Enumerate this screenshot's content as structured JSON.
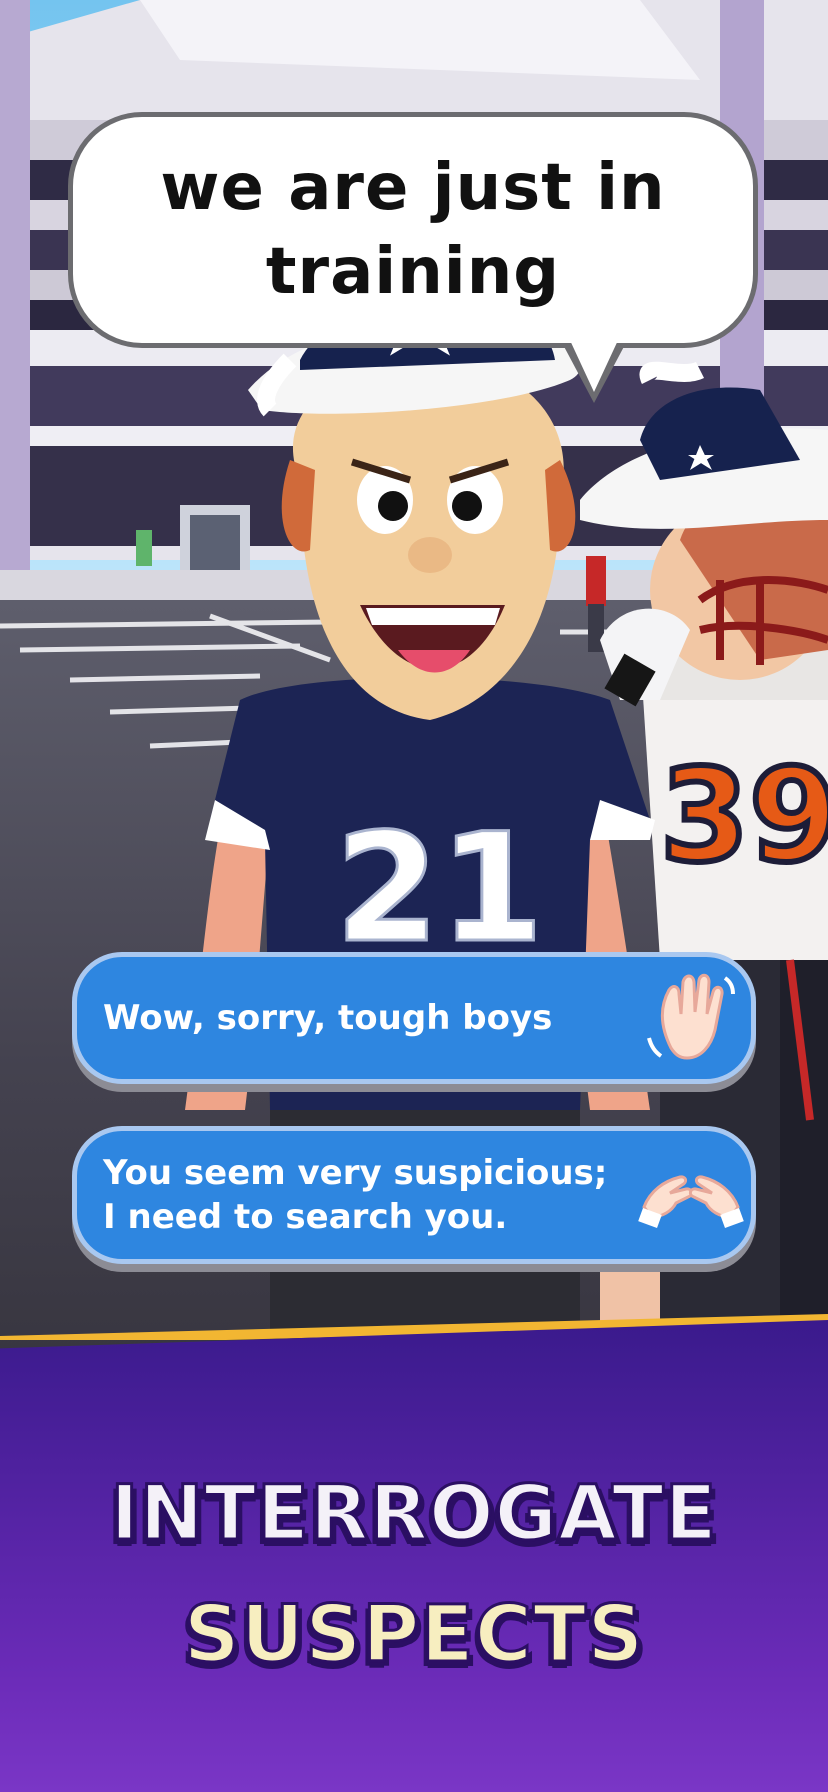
{
  "speech": {
    "text": "we are just in training"
  },
  "replies": [
    {
      "label": "Wow, sorry, tough boys",
      "icon": "waving-hand-icon"
    },
    {
      "label": "You seem very suspicious; I need to search you.",
      "icon": "hands-frame-icon"
    }
  ],
  "characters": {
    "mascot_jersey_number": "21",
    "player_jersey_number": "39"
  },
  "banner": {
    "line1": "INTERROGATE",
    "line2": "SUSPECTS"
  },
  "colors": {
    "reply_button": "#2e86e0",
    "banner_purple": "#6b2bb8",
    "banner_stripe": "#f2b632",
    "title_line2": "#f7eec0"
  }
}
